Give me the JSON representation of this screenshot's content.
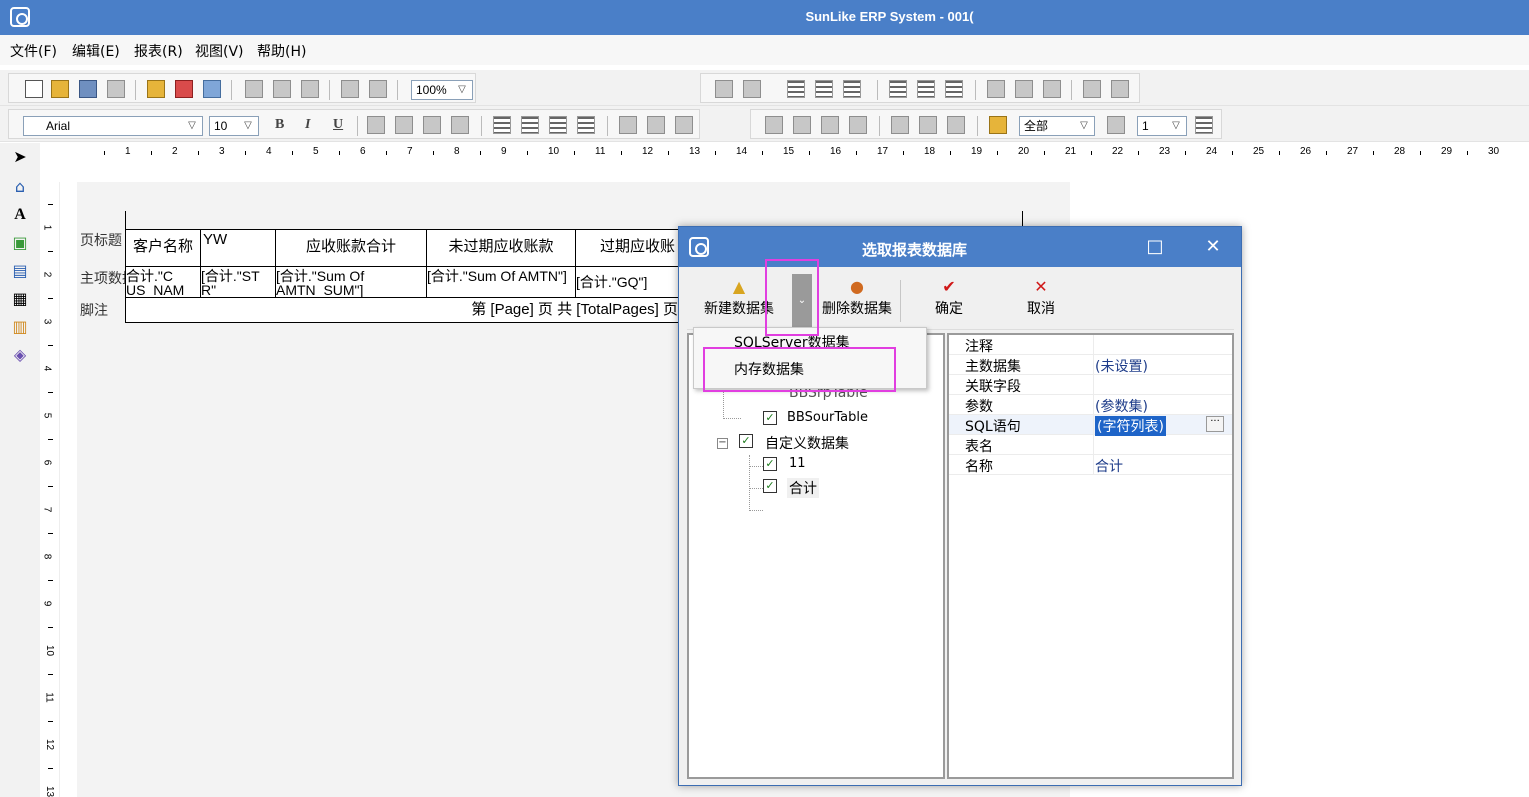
{
  "window": {
    "title": "SunLike ERP System - 001("
  },
  "menu": [
    "文件(F)",
    "编辑(E)",
    "报表(R)",
    "视图(V)",
    "帮助(H)"
  ],
  "toolbar": {
    "zoom": "100%",
    "font": "Arial",
    "font_size": "10",
    "scope": "全部",
    "line_width": "1",
    "bold": "B",
    "italic": "I",
    "underline": "U"
  },
  "palette": {
    "text_tool": "A"
  },
  "ruler_h": [
    "1",
    "2",
    "3",
    "4",
    "5",
    "6",
    "7",
    "8",
    "9",
    "10",
    "11",
    "12",
    "13",
    "14",
    "15",
    "16",
    "17",
    "18",
    "19",
    "20",
    "21",
    "22",
    "23",
    "24",
    "25",
    "26",
    "27",
    "28",
    "29",
    "30"
  ],
  "ruler_v": [
    "1",
    "2",
    "3",
    "4",
    "5",
    "6",
    "7",
    "8",
    "9",
    "10",
    "11",
    "12",
    "13"
  ],
  "report": {
    "bands": {
      "header": "页标题",
      "detail": "主项数据",
      "footer": "脚注"
    },
    "header_cells": [
      "客户名称",
      "YW",
      "应收账款合计",
      "未过期应收账款",
      "过期应收账"
    ],
    "detail_cells": [
      "合计.\"C US_NAM",
      "[合计.\"ST R\"  ",
      "[合计.\"Sum Of AMTN_SUM\"]",
      "[合计.\"Sum Of AMTN\"]",
      "[合计.\"GQ\"]"
    ],
    "footer_text": "第 [Page] 页 共 [TotalPages] 页"
  },
  "dialog": {
    "title": "选取报表数据库",
    "maximize": "□",
    "close": "✕",
    "toolbar": {
      "new_dataset": "新建数据集",
      "split_arrow": "⌄",
      "delete_dataset": "删除数据集",
      "confirm": "确定",
      "cancel": "取消"
    },
    "dropdown": [
      "SQLServer数据集",
      "内存数据集"
    ],
    "tree": {
      "partial_top": "BBSrpTable",
      "item_bbsour": "BBSourTable",
      "group_custom": "自定义数据集",
      "item_11": "11",
      "item_total": "合计"
    },
    "properties": [
      {
        "name": "注释",
        "value": ""
      },
      {
        "name": "主数据集",
        "value": "(未设置)"
      },
      {
        "name": "关联字段",
        "value": ""
      },
      {
        "name": "参数",
        "value": "(参数集)"
      },
      {
        "name": "SQL语句",
        "value": "(字符列表)"
      },
      {
        "name": "表名",
        "value": ""
      },
      {
        "name": "名称",
        "value": "合计"
      }
    ],
    "ellipsis": "···"
  },
  "colors": {
    "title_bar": "#4a7fc8",
    "highlight": "#e13ee0",
    "selection": "#1e64c8"
  }
}
